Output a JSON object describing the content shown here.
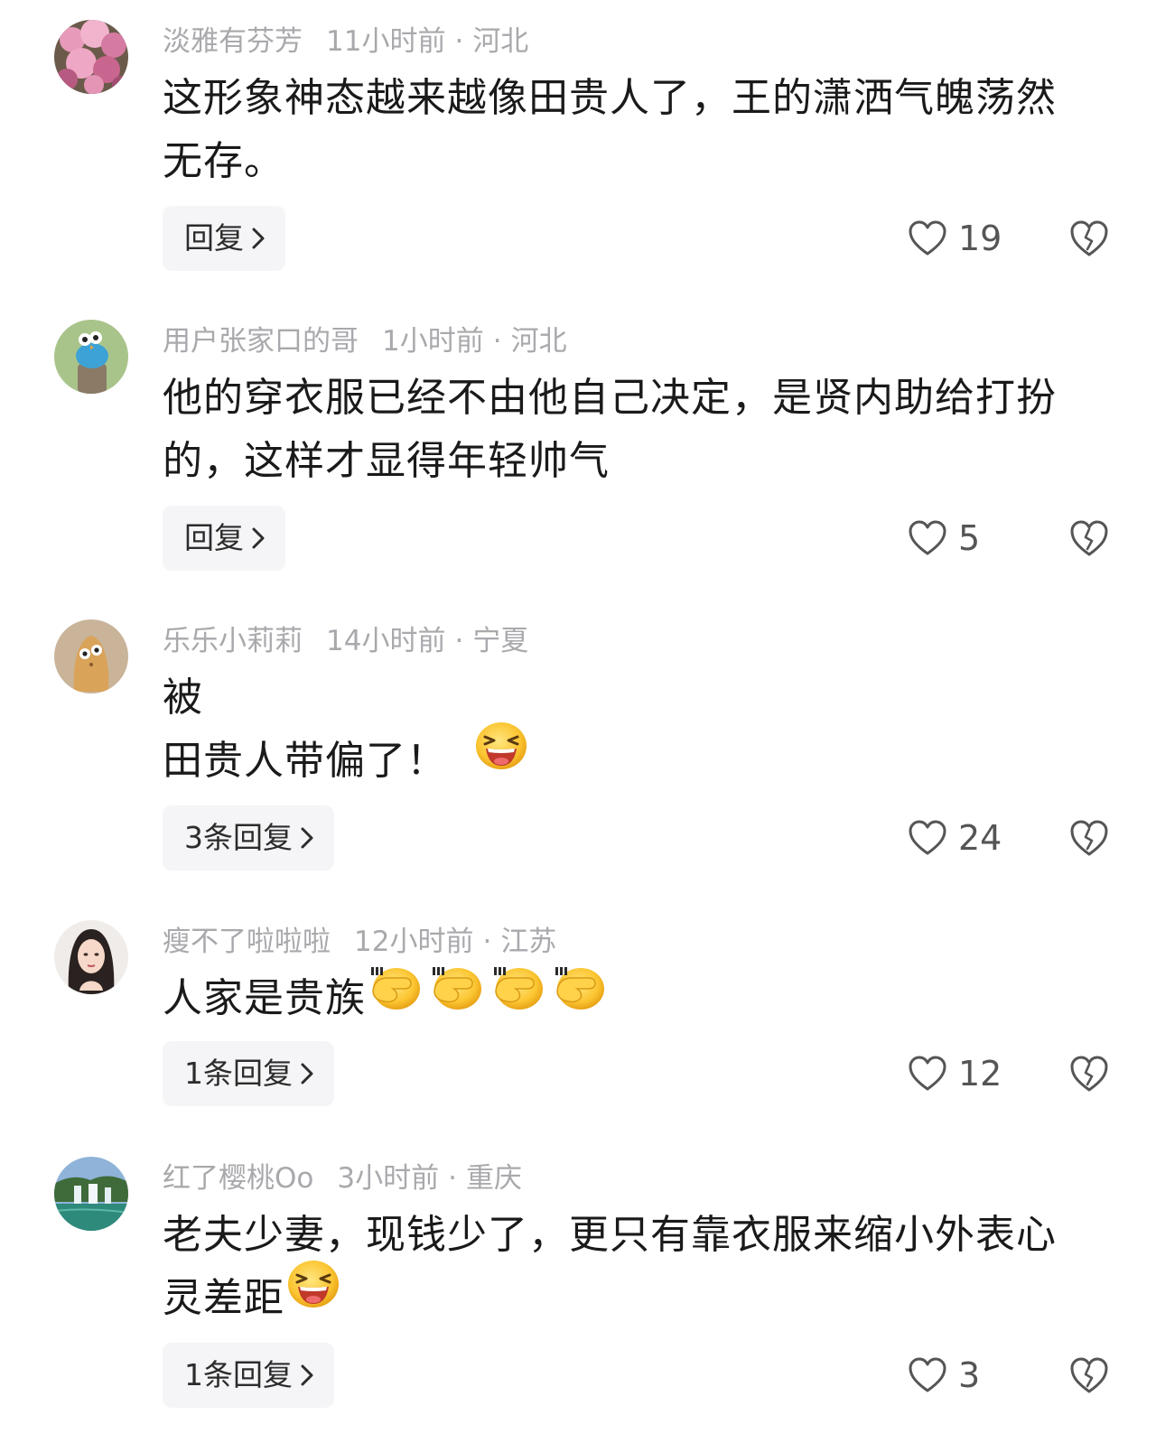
{
  "comments": [
    {
      "username": "淡雅有芬芳",
      "time": "11小时前",
      "location": "河北",
      "text": "这形象神态越来越像田贵人了，王的潇洒气魄荡然\n无存。",
      "reply_label": "回复",
      "likes": "19",
      "avatar_icon": "pink-flower-avatar"
    },
    {
      "username": "用户张家口的哥",
      "time": "1小时前",
      "location": "河北",
      "text": "他的穿衣服已经不由他自己决定，是贤内助给打扮\n的，这样才显得年轻帅气",
      "reply_label": "回复",
      "likes": "5",
      "avatar_icon": "cartoon-bird-avatar"
    },
    {
      "username": "乐乐小莉莉",
      "time": "14小时前",
      "location": "宁夏",
      "text": "被\n田贵人带偏了！",
      "reply_label": "3条回复",
      "likes": "24",
      "avatar_icon": "cartoon-potato-avatar"
    },
    {
      "username": "瘦不了啦啦啦",
      "time": "12小时前",
      "location": "江苏",
      "text": "人家是贵族",
      "reply_label": "1条回复",
      "likes": "12",
      "avatar_icon": "woman-portrait-avatar"
    },
    {
      "username": "红了樱桃Oo",
      "time": "3小时前",
      "location": "重庆",
      "text": "老夫少妻，现钱少了，更只有靠衣服来缩小外表心\n灵差距",
      "reply_label": "1条回复",
      "likes": "3",
      "avatar_icon": "waterfall-landscape-avatar"
    }
  ],
  "separator": "·",
  "icons": {
    "like": "heart-outline-icon",
    "dislike": "broken-heart-icon",
    "chevron": "chevron-right-icon",
    "emoji_laugh": "laughing-emoji",
    "emoji_facepalm": "facepalm-emoji"
  }
}
